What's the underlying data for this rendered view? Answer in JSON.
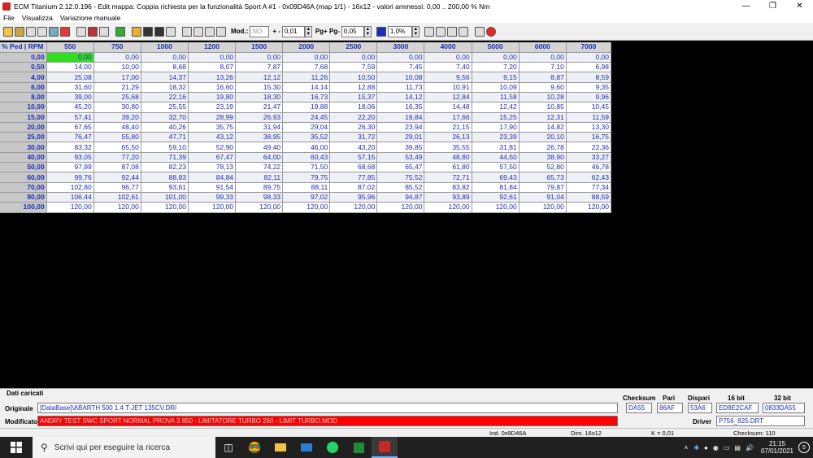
{
  "window": {
    "title": "ECM Titanium 2.12.0.196 - Edit mappa: Coppia richiesta per la funzionalità Sport A #1 - 0x09D46A (map 1/1) - 16x12 - valori ammessi: 0,00 .. 200,00 % Nm"
  },
  "menu": [
    "File",
    "Visualizza",
    "Variazione manuale"
  ],
  "toolbar": {
    "mod_label": "Mod.:",
    "mod_value": "NO",
    "plusminus_label": "+ -",
    "step_value": "0,01",
    "pg_label": "Pg+ Pg-",
    "pg_value": "0,05",
    "percent_value": "1,0%"
  },
  "table": {
    "corner": "% Ped | RPM",
    "columns": [
      "550",
      "750",
      "1000",
      "1200",
      "1500",
      "2000",
      "2500",
      "3000",
      "4000",
      "5000",
      "6000",
      "7000"
    ],
    "rows": [
      {
        "label": "0,00",
        "values": [
          "0,00",
          "0,00",
          "0,00",
          "0,00",
          "0,00",
          "0,00",
          "0,00",
          "0,00",
          "0,00",
          "0,00",
          "0,00",
          "0,00"
        ]
      },
      {
        "label": "0,50",
        "values": [
          "14,00",
          "10,00",
          "8,68",
          "8,07",
          "7,87",
          "7,68",
          "7,59",
          "7,45",
          "7,40",
          "7,20",
          "7,10",
          "6,98"
        ]
      },
      {
        "label": "4,00",
        "values": [
          "25,08",
          "17,00",
          "14,37",
          "13,26",
          "12,12",
          "11,26",
          "10,50",
          "10,08",
          "9,56",
          "9,15",
          "8,87",
          "8,59"
        ]
      },
      {
        "label": "6,00",
        "values": [
          "31,60",
          "21,29",
          "18,32",
          "16,60",
          "15,30",
          "14,14",
          "12,88",
          "11,73",
          "10,91",
          "10,09",
          "9,60",
          "9,35"
        ]
      },
      {
        "label": "8,00",
        "values": [
          "39,00",
          "25,68",
          "22,16",
          "19,80",
          "18,30",
          "16,73",
          "15,37",
          "14,12",
          "12,84",
          "11,58",
          "10,28",
          "9,96"
        ]
      },
      {
        "label": "10,00",
        "values": [
          "45,20",
          "30,80",
          "25,55",
          "23,19",
          "21,47",
          "19,88",
          "18,06",
          "16,35",
          "14,48",
          "12,42",
          "10,85",
          "10,45"
        ]
      },
      {
        "label": "15,00",
        "values": [
          "57,41",
          "39,20",
          "32,70",
          "28,99",
          "26,93",
          "24,45",
          "22,20",
          "19,84",
          "17,66",
          "15,25",
          "12,31",
          "11,59"
        ]
      },
      {
        "label": "20,00",
        "values": [
          "67,65",
          "48,40",
          "40,26",
          "35,75",
          "31,94",
          "29,04",
          "26,30",
          "23,94",
          "21,15",
          "17,90",
          "14,82",
          "13,30"
        ]
      },
      {
        "label": "25,00",
        "values": [
          "76,47",
          "55,80",
          "47,71",
          "43,12",
          "38,95",
          "35,52",
          "31,72",
          "29,01",
          "26,13",
          "23,39",
          "20,10",
          "16,75"
        ]
      },
      {
        "label": "30,00",
        "values": [
          "83,32",
          "65,50",
          "59,10",
          "52,90",
          "49,40",
          "46,00",
          "43,20",
          "39,85",
          "35,55",
          "31,81",
          "26,78",
          "22,36"
        ]
      },
      {
        "label": "40,00",
        "values": [
          "93,05",
          "77,20",
          "71,39",
          "67,47",
          "64,00",
          "60,43",
          "57,15",
          "53,49",
          "48,80",
          "44,50",
          "38,90",
          "33,27"
        ]
      },
      {
        "label": "50,00",
        "values": [
          "97,99",
          "87,08",
          "82,23",
          "78,13",
          "74,22",
          "71,50",
          "68,68",
          "65,47",
          "61,80",
          "57,50",
          "52,80",
          "46,78"
        ]
      },
      {
        "label": "60,00",
        "values": [
          "99,76",
          "92,44",
          "88,83",
          "84,84",
          "82,11",
          "79,75",
          "77,85",
          "75,52",
          "72,71",
          "69,43",
          "65,73",
          "62,43"
        ]
      },
      {
        "label": "70,00",
        "values": [
          "102,80",
          "96,77",
          "93,61",
          "91,54",
          "89,75",
          "88,11",
          "87,02",
          "85,52",
          "83,82",
          "81,84",
          "79,87",
          "77,34"
        ]
      },
      {
        "label": "80,00",
        "values": [
          "106,44",
          "102,61",
          "101,00",
          "99,33",
          "98,33",
          "97,02",
          "95,96",
          "94,87",
          "93,89",
          "92,61",
          "91,04",
          "88,59"
        ]
      },
      {
        "label": "100,00",
        "values": [
          "120,00",
          "120,00",
          "120,00",
          "120,00",
          "120,00",
          "120,00",
          "120,00",
          "120,00",
          "120,00",
          "120,00",
          "120,00",
          "120,00"
        ]
      }
    ]
  },
  "bottom": {
    "section_title": "Dati caricati",
    "originale_label": "Originale",
    "originale_value": "[DataBase]\\ABARTH 500 1.4 T-JET 135CV.DRI",
    "modificato_label": "Modificato",
    "modificato_value": "ANDRY TEST SWC SPORT NORMAL PROVA 3 850 - LIMITATORE TURBO 260 - LIMIT TURBO.MOD",
    "checksum_label": "Checksum",
    "checksum_value": "DA55",
    "pari_label": "Pari",
    "pari_value": "86AF",
    "dispari_label": "Dispari",
    "dispari_value": "53A6",
    "bit16_label": "16 bit",
    "bit16_value": "ED9E2CAF",
    "bit32_label": "32 bit",
    "bit32_value": "0833DA55",
    "driver_label": "Driver",
    "driver_value": "P756_825.DRT"
  },
  "status": {
    "ind": "Ind. 0x9D46A",
    "dim": "Dim. 16x12",
    "k": "K = 0,01",
    "checksum": "Checksum: 110"
  },
  "taskbar": {
    "search_placeholder": "Scrivi qui per eseguire la ricerca",
    "time": "21:15",
    "date": "07/01/2021",
    "notification_count": "5"
  }
}
